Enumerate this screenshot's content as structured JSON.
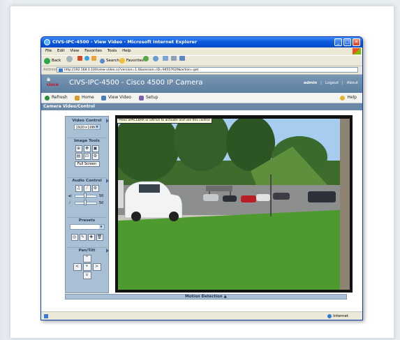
{
  "window": {
    "title": "CIVS-IPC-4500 - View Video - Microsoft Internet Explorer",
    "minimize_glyph": "_",
    "maximize_glyph": "□",
    "close_glyph": "✕"
  },
  "menu": [
    "File",
    "Edit",
    "View",
    "Favorites",
    "Tools",
    "Help"
  ],
  "toolbar": {
    "back": "Back",
    "search": "Search",
    "favorites": "Favorites"
  },
  "address": {
    "label": "Address",
    "url": "http://192.168.0.100/view-video.cs?version=1.0&session=ID=94557629&action=get"
  },
  "header": {
    "logo_bars": "ılıılı",
    "logo_text": "cisco",
    "title": "CIVS-IPC-4500 - Cisco 4500 IP Camera",
    "user": "admin",
    "logout": "Logout",
    "about": "About",
    "separator": "|"
  },
  "nav": {
    "refresh": "Refresh",
    "home": "Home",
    "view_video": "View Video",
    "setup": "Setup",
    "help": "Help"
  },
  "section_title": "Camera Video/Control",
  "controls": {
    "video_control": {
      "title": "Video Control",
      "resolution": "1920×1080",
      "dropdown_arrow": "▼"
    },
    "image_tools": {
      "title": "Image Tools",
      "full_screen": "Full Screen"
    },
    "audio_control": {
      "title": "Audio Control",
      "volume": "50",
      "mic": "50",
      "volume_sym": "◄)",
      "mic_sym": "♪"
    },
    "presets": {
      "title": "Presets",
      "dropdown_arrow": "▼"
    },
    "pan_tilt": {
      "title": "Pan/Tilt",
      "up": "^",
      "left": "<",
      "center": "•",
      "right": ">",
      "down": "v"
    }
  },
  "video": {
    "tooltip": "Press SPACEBAR or ENTER to activate and use this control"
  },
  "motion_detection": "Motion Detection ▲",
  "status": {
    "zone": "Internet"
  },
  "colors": {
    "title_bar": "#0d5ae0",
    "cisco_header": "#6a88a6",
    "panel": "#a9c0d4",
    "grass": "#4f9a2f"
  }
}
